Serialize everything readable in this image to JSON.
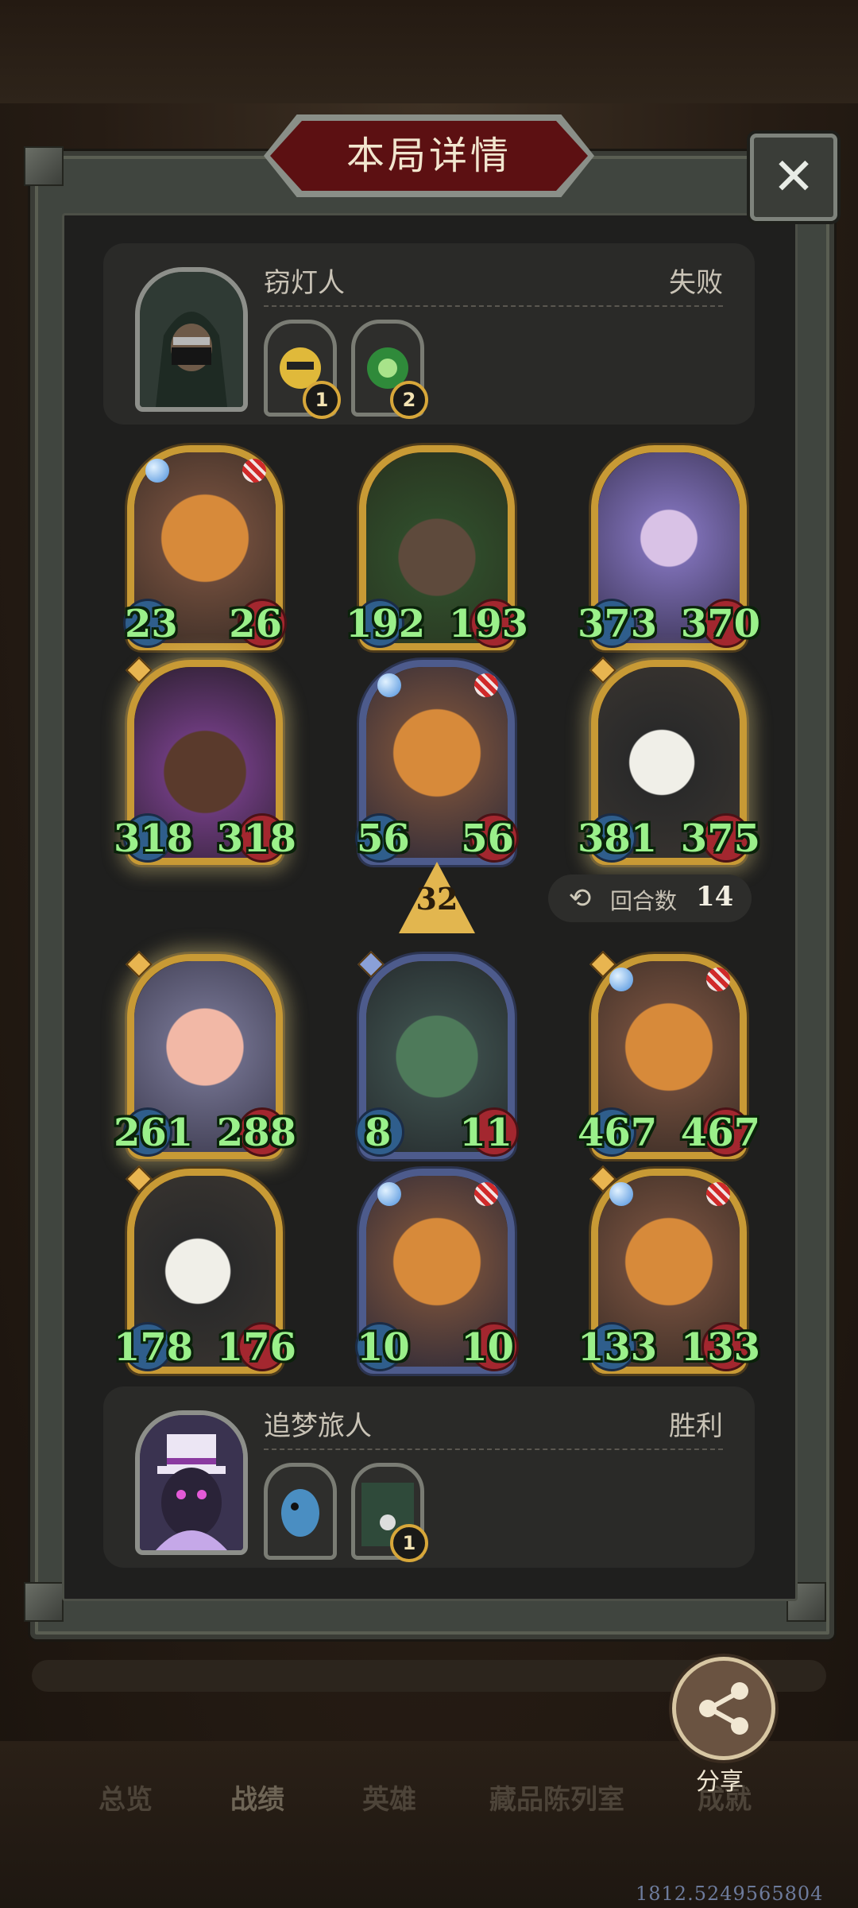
{
  "header": {
    "title": "本局详情"
  },
  "opponent": {
    "name": "窃灯人",
    "result": "失败",
    "items": [
      {
        "badge": "1"
      },
      {
        "badge": "2"
      }
    ]
  },
  "opponent_board": [
    {
      "atk": "23",
      "hp": "26"
    },
    {
      "atk": "192",
      "hp": "193"
    },
    {
      "atk": "373",
      "hp": "370"
    },
    {
      "atk": "318",
      "hp": "318"
    },
    {
      "atk": "56",
      "hp": "56"
    },
    {
      "atk": "381",
      "hp": "375"
    }
  ],
  "player_board": [
    {
      "atk": "261",
      "hp": "288"
    },
    {
      "atk": "8",
      "hp": "11"
    },
    {
      "atk": "467",
      "hp": "467"
    },
    {
      "atk": "178",
      "hp": "176"
    },
    {
      "atk": "10",
      "hp": "10"
    },
    {
      "atk": "133",
      "hp": "133"
    }
  ],
  "tier": "32",
  "turns": {
    "label": "回合数",
    "value": "14"
  },
  "player": {
    "name": "追梦旅人",
    "result": "胜利",
    "items": [
      {
        "badge": ""
      },
      {
        "badge": "1"
      }
    ]
  },
  "share": {
    "label": "分享"
  },
  "nav": [
    "总览",
    "战绩",
    "英雄",
    "藏品陈列室",
    "成就"
  ],
  "watermark": "1812.5249565804",
  "colors": {
    "stat_text": "#9af08a",
    "gold_frame": "#c89a35",
    "silver_frame": "#4d5b8c",
    "defeat_plate": "#5c1012"
  }
}
